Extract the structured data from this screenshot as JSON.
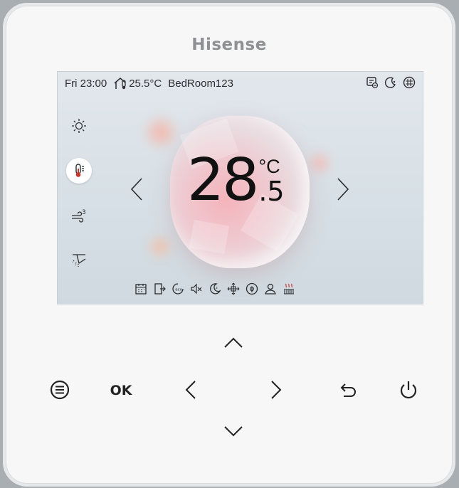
{
  "brand": "Hisense",
  "status": {
    "day_time": "Fri 23:00",
    "indoor_temp": "25.5°C",
    "room_name": "BedRoom123",
    "icons": [
      "screen-lock-icon",
      "sleep-mode-icon",
      "grid-lock-icon"
    ]
  },
  "modes": [
    {
      "name": "sun-icon",
      "active": false
    },
    {
      "name": "thermometer-icon",
      "active": true
    },
    {
      "name": "fan-speed-icon",
      "active": false
    },
    {
      "name": "swing-louver-icon",
      "active": false
    }
  ],
  "setpoint": {
    "integer": "28",
    "decimal": ".5",
    "unit": "°C"
  },
  "function_icons": [
    "calendar-icon",
    "exit-icon",
    "eco-icon",
    "mute-icon",
    "sleep-icon",
    "swing-icon",
    "leaf-icon",
    "user-icon",
    "heater-icon"
  ],
  "keypad": {
    "ok_label": "OK"
  },
  "colors": {
    "brand": "#8e9094",
    "accent": "#f1a9b3",
    "panel": "#f7f7f8"
  }
}
